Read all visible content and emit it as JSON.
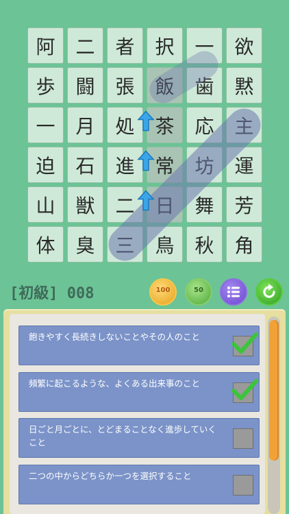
{
  "grid": {
    "rows": [
      [
        "阿",
        "二",
        "者",
        "択",
        "一",
        "欲"
      ],
      [
        "歩",
        "闘",
        "張",
        "飯",
        "歯",
        "黙"
      ],
      [
        "一",
        "月",
        "処",
        "茶",
        "応",
        "主"
      ],
      [
        "迫",
        "石",
        "進",
        "常",
        "坊",
        "運"
      ],
      [
        "山",
        "獣",
        "二",
        "日",
        "舞",
        "芳"
      ],
      [
        "体",
        "臭",
        "三",
        "鳥",
        "秋",
        "角"
      ]
    ],
    "shaded_column": 3,
    "shaded_rows": [
      1,
      2,
      3,
      4
    ]
  },
  "level": {
    "title": "[初級] 008"
  },
  "hud": {
    "hint100_label": "100",
    "hint50_label": "50",
    "menu_icon": "list-icon",
    "restart_icon": "restart-icon"
  },
  "clues": [
    {
      "text": "飽きやすく長続きしないことやその人のこと",
      "checked": true
    },
    {
      "text": "頻繁に起こるような、よくある出来事のこと",
      "checked": true
    },
    {
      "text": "日ごと月ごとに、とどまることなく進歩していくこと",
      "checked": false
    },
    {
      "text": "二つの中からどちらか一つを選択すること",
      "checked": false
    }
  ],
  "colors": {
    "background": "#6cc396",
    "cell": "#cfe9d8",
    "clue": "#7b93c8",
    "check": "#3cc43c",
    "scroll_thumb": "#f2a136"
  }
}
